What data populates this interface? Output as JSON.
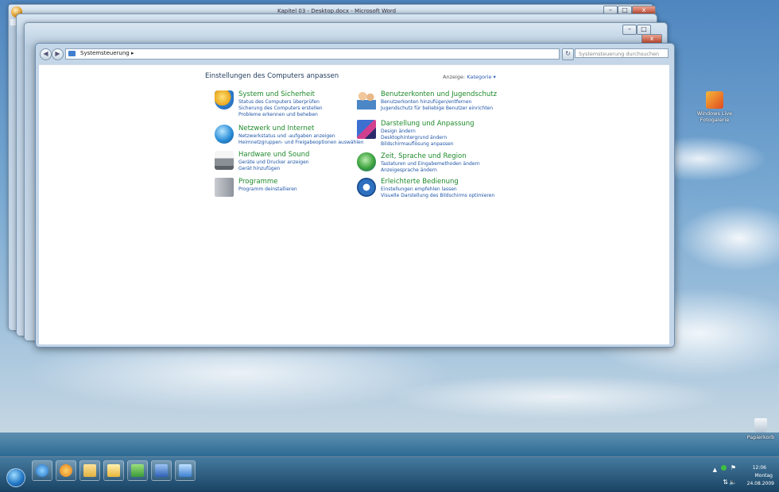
{
  "front_window": {
    "breadcrumb": "Systemsteuerung ▸",
    "search_placeholder": "Systemsteuerung durchsuchen",
    "heading": "Einstellungen des Computers anpassen",
    "view_label": "Anzeige:",
    "view_value": "Kategorie ▾"
  },
  "back_window": {
    "title": "Kapitel 03 - Desktop.docx - Microsoft Word"
  },
  "categories": [
    {
      "title": "System und Sicherheit",
      "links": [
        "Status des Computers überprüfen",
        "Sicherung des Computers erstellen",
        "Probleme erkennen und beheben"
      ]
    },
    {
      "title": "Netzwerk und Internet",
      "links": [
        "Netzwerkstatus und -aufgaben anzeigen",
        "Heimnetzgruppen- und Freigabeoptionen auswählen"
      ]
    },
    {
      "title": "Hardware und Sound",
      "links": [
        "Geräte und Drucker anzeigen",
        "Gerät hinzufügen"
      ]
    },
    {
      "title": "Programme",
      "links": [
        "Programm deinstallieren"
      ]
    },
    {
      "title": "Benutzerkonten und Jugendschutz",
      "links": [
        "Benutzerkonten hinzufügen/entfernen",
        "Jugendschutz für beliebige Benutzer einrichten"
      ]
    },
    {
      "title": "Darstellung und Anpassung",
      "links": [
        "Design ändern",
        "Desktophintergrund ändern",
        "Bildschirmauflösung anpassen"
      ]
    },
    {
      "title": "Zeit, Sprache und Region",
      "links": [
        "Tastaturen und Eingabemethoden ändern",
        "Anzeigesprache ändern"
      ]
    },
    {
      "title": "Erleichterte Bedienung",
      "links": [
        "Einstellungen empfehlen lassen",
        "Visuelle Darstellung des Bildschirms optimieren"
      ]
    }
  ],
  "desktop_icons": [
    {
      "label": "Windows Live Fotogalerie"
    },
    {
      "label": "Papierkorb"
    }
  ],
  "tray": {
    "time": "12:06",
    "day": "Montag",
    "date": "24.08.2009"
  },
  "colors": {
    "category_title": "#1e8a2a",
    "link": "#1f55a8",
    "heading": "#1e395b"
  }
}
